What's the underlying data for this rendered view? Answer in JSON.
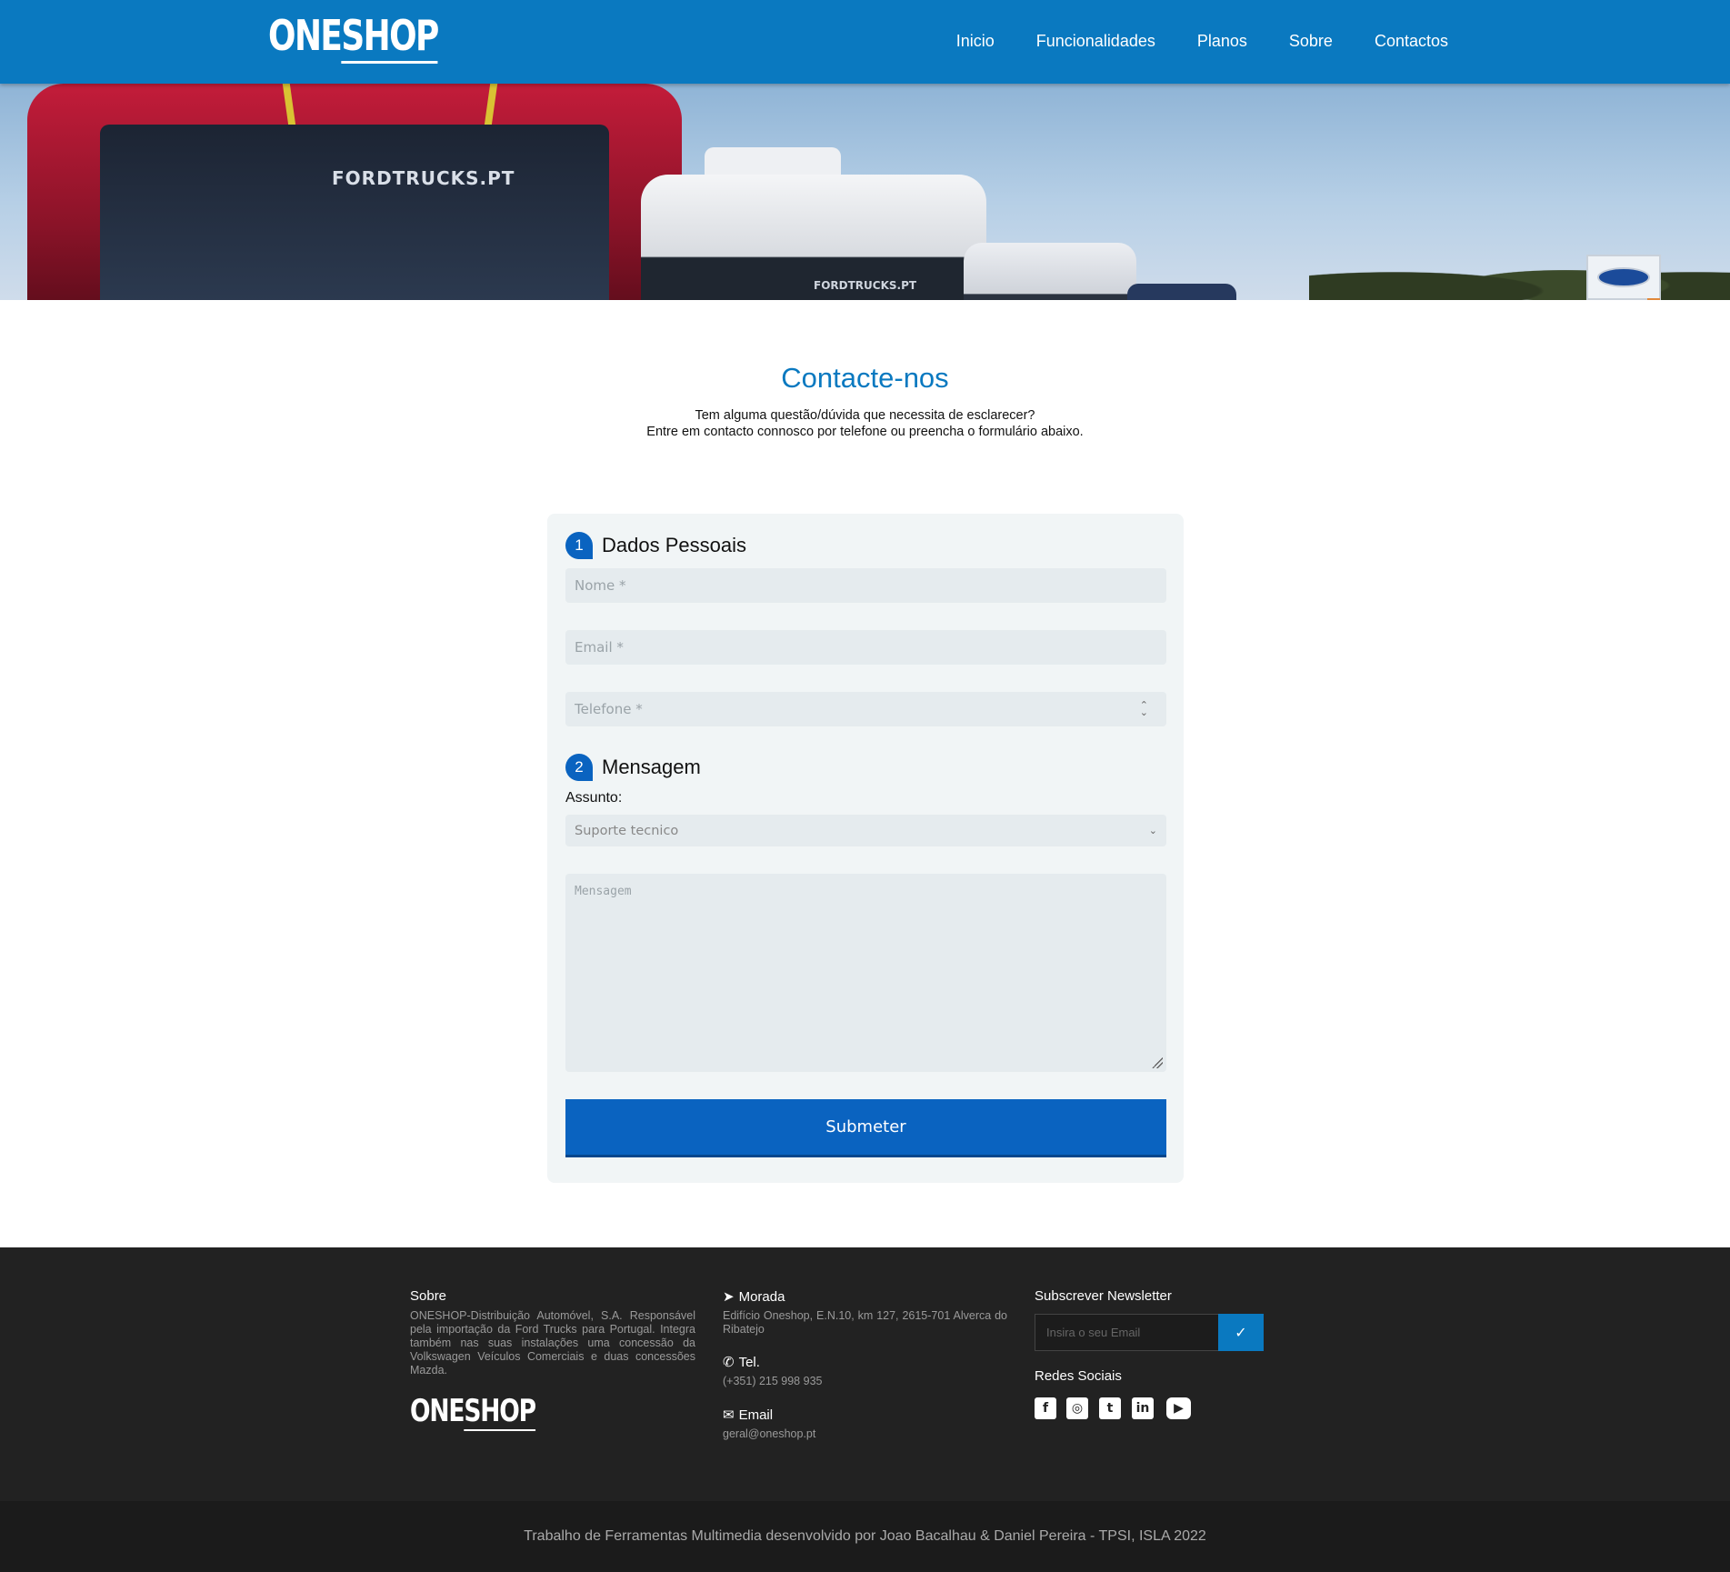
{
  "header": {
    "logo": {
      "part1": "ONE",
      "part2": "SHOP"
    },
    "nav": [
      "Inicio",
      "Funcionalidades",
      "Planos",
      "Sobre",
      "Contactos"
    ]
  },
  "hero": {
    "truck_label_1": "FORDTRUCKS.PT",
    "truck_label_2": "FORDTRUCKS.PT"
  },
  "contact": {
    "title": "Contacte-nos",
    "subtitle_line1": "Tem alguma questão/dúvida que necessita de esclarecer?",
    "subtitle_line2": "Entre em contacto connosco por telefone ou preencha o formulário abaixo."
  },
  "form": {
    "step1": {
      "num": "1",
      "title": "Dados Pessoais"
    },
    "name_placeholder": "Nome *",
    "email_placeholder": "Email *",
    "phone_placeholder": "Telefone *",
    "step2": {
      "num": "2",
      "title": "Mensagem"
    },
    "subject_label": "Assunto:",
    "subject_value": "Suporte tecnico",
    "message_placeholder": "Mensagem",
    "submit_label": "Submeter"
  },
  "footer": {
    "about": {
      "title": "Sobre",
      "text": "ONESHOP-Distribuição Automóvel, S.A. Responsável pela importação da Ford Trucks para Portugal. Integra também nas suas instalações uma concessão da Volkswagen Veículos Comerciais e duas concessões Mazda."
    },
    "address": {
      "title": "Morada",
      "text": "Edifício Oneshop, E.N.10, km 127, 2615-701 Alverca do Ribatejo"
    },
    "phone": {
      "title": "Tel.",
      "text": "(+351) 215 998 935"
    },
    "email": {
      "title": "Email",
      "text": "geral@oneshop.pt"
    },
    "newsletter": {
      "title": "Subscrever Newsletter",
      "placeholder": "Insira o seu Email"
    },
    "social": {
      "title": "Redes Sociais",
      "icons": [
        "facebook-icon",
        "instagram-icon",
        "twitter-icon",
        "linkedin-icon",
        "youtube-icon"
      ]
    },
    "credits": "Trabalho de Ferramentas Multimedia desenvolvido por Joao Bacalhau & Daniel Pereira - TPSI, ISLA 2022"
  },
  "colors": {
    "primary": "#0a79c0",
    "button": "#0a63c0",
    "footer_bg": "#222222",
    "card_bg": "#f1f5f6"
  }
}
